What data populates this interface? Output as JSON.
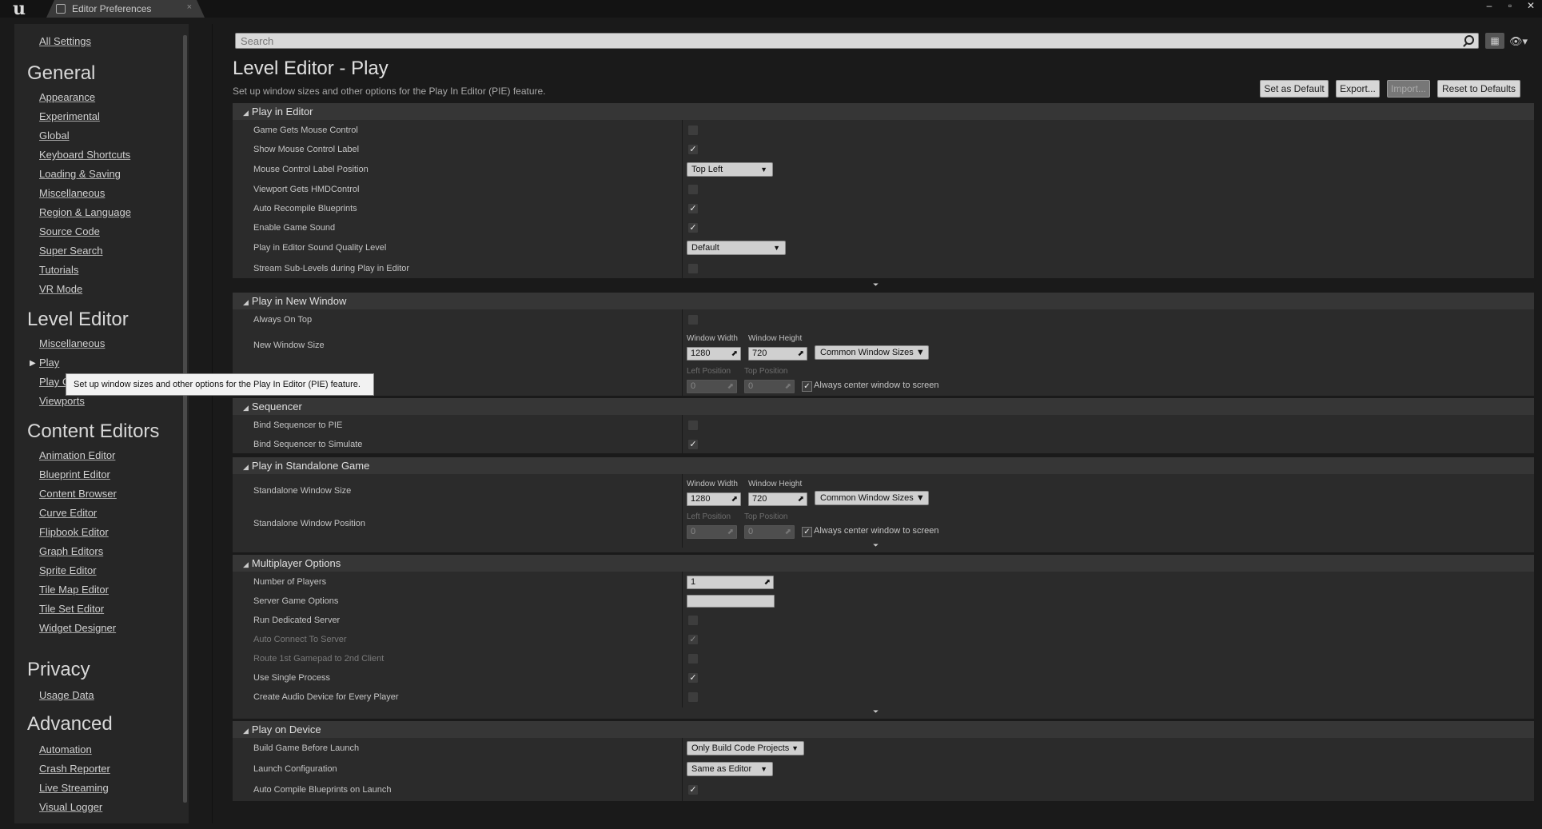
{
  "titlebar": {
    "tab_label": "Editor Preferences",
    "tab_close": "×",
    "window_buttons": [
      "–",
      "▫",
      "✕"
    ]
  },
  "sidebar": {
    "all_settings": "All Settings",
    "groups": [
      {
        "heading": "General",
        "items": [
          "Appearance",
          "Experimental",
          "Global",
          "Keyboard Shortcuts",
          "Loading & Saving",
          "Miscellaneous",
          "Region & Language",
          "Source Code",
          "Super Search",
          "Tutorials",
          "VR Mode"
        ]
      },
      {
        "heading": "Level Editor",
        "items": [
          "Miscellaneous",
          "Play",
          "Play C",
          "Viewports"
        ]
      },
      {
        "heading": "Content Editors",
        "items": [
          "Animation Editor",
          "Blueprint Editor",
          "Content Browser",
          "Curve Editor",
          "Flipbook Editor",
          "Graph Editors",
          "Sprite Editor",
          "Tile Map Editor",
          "Tile Set Editor",
          "Widget Designer"
        ]
      },
      {
        "heading": "Privacy",
        "items": [
          "Usage Data"
        ]
      },
      {
        "heading": "Advanced",
        "items": [
          "Automation",
          "Crash Reporter",
          "Live Streaming",
          "Visual Logger"
        ]
      }
    ],
    "active_marker": "▶"
  },
  "search": {
    "placeholder": "Search"
  },
  "header": {
    "title": "Level Editor - Play",
    "description": "Set up window sizes and other options for the Play In Editor (PIE) feature.",
    "buttons": {
      "set_default": "Set as Default",
      "export": "Export...",
      "import": "Import...",
      "reset": "Reset to Defaults"
    }
  },
  "tooltip": "Set up window sizes and other options for the Play In Editor (PIE) feature.",
  "sections": {
    "play_in_editor": {
      "title": "Play in Editor",
      "rows": {
        "game_gets_mouse": {
          "label": "Game Gets Mouse Control",
          "checked": false
        },
        "show_mouse_label": {
          "label": "Show Mouse Control Label",
          "checked": true
        },
        "mouse_label_pos": {
          "label": "Mouse Control Label Position",
          "value": "Top Left"
        },
        "viewport_hmd": {
          "label": "Viewport Gets HMDControl",
          "checked": false
        },
        "auto_recompile": {
          "label": "Auto Recompile Blueprints",
          "checked": true
        },
        "enable_sound": {
          "label": "Enable Game Sound",
          "checked": true
        },
        "sound_quality": {
          "label": "Play in Editor Sound Quality Level",
          "value": "Default"
        },
        "stream_sublevels": {
          "label": "Stream Sub-Levels during Play in Editor",
          "checked": false
        }
      }
    },
    "play_in_new_window": {
      "title": "Play in New Window",
      "rows": {
        "always_on_top": {
          "label": "Always On Top",
          "checked": false
        },
        "new_window_size": {
          "label": "New Window Size"
        }
      },
      "size": {
        "width_label": "Window Width",
        "height_label": "Window Height",
        "width": "1280",
        "height": "720",
        "common_sizes": "Common Window Sizes"
      },
      "position": {
        "left_label": "Left Position",
        "top_label": "Top Position",
        "left": "0",
        "top": "0",
        "center_label": "Always center window to screen",
        "center_checked": true
      }
    },
    "sequencer": {
      "title": "Sequencer",
      "rows": {
        "bind_pie": {
          "label": "Bind Sequencer to PIE",
          "checked": false
        },
        "bind_simulate": {
          "label": "Bind Sequencer to Simulate",
          "checked": true
        }
      }
    },
    "standalone": {
      "title": "Play in Standalone Game",
      "rows": {
        "size": {
          "label": "Standalone Window Size"
        },
        "position": {
          "label": "Standalone Window Position"
        }
      },
      "size": {
        "width_label": "Window Width",
        "height_label": "Window Height",
        "width": "1280",
        "height": "720",
        "common_sizes": "Common Window Sizes"
      },
      "position": {
        "left_label": "Left Position",
        "top_label": "Top Position",
        "left": "0",
        "top": "0",
        "center_label": "Always center window to screen",
        "center_checked": true
      }
    },
    "multiplayer": {
      "title": "Multiplayer Options",
      "rows": {
        "num_players": {
          "label": "Number of Players",
          "value": "1"
        },
        "server_options": {
          "label": "Server Game Options",
          "value": ""
        },
        "dedicated": {
          "label": "Run Dedicated Server",
          "checked": false
        },
        "auto_connect": {
          "label": "Auto Connect To Server",
          "checked": true
        },
        "route_gamepad": {
          "label": "Route 1st Gamepad to 2nd Client",
          "checked": false
        },
        "single_process": {
          "label": "Use Single Process",
          "checked": true
        },
        "audio_device": {
          "label": "Create Audio Device for Every Player",
          "checked": false
        }
      }
    },
    "device": {
      "title": "Play on Device",
      "rows": {
        "build_game": {
          "label": "Build Game Before Launch",
          "value": "Only Build Code Projects"
        },
        "launch_config": {
          "label": "Launch Configuration",
          "value": "Same as Editor"
        },
        "auto_compile": {
          "label": "Auto Compile Blueprints on Launch",
          "checked": true
        }
      }
    }
  },
  "glyphs": {
    "check": "✓",
    "tri_open": "◢",
    "down": "▼",
    "drag": "⬈",
    "expand": "⏷",
    "grid": "▦",
    "eye": "👁▾"
  }
}
